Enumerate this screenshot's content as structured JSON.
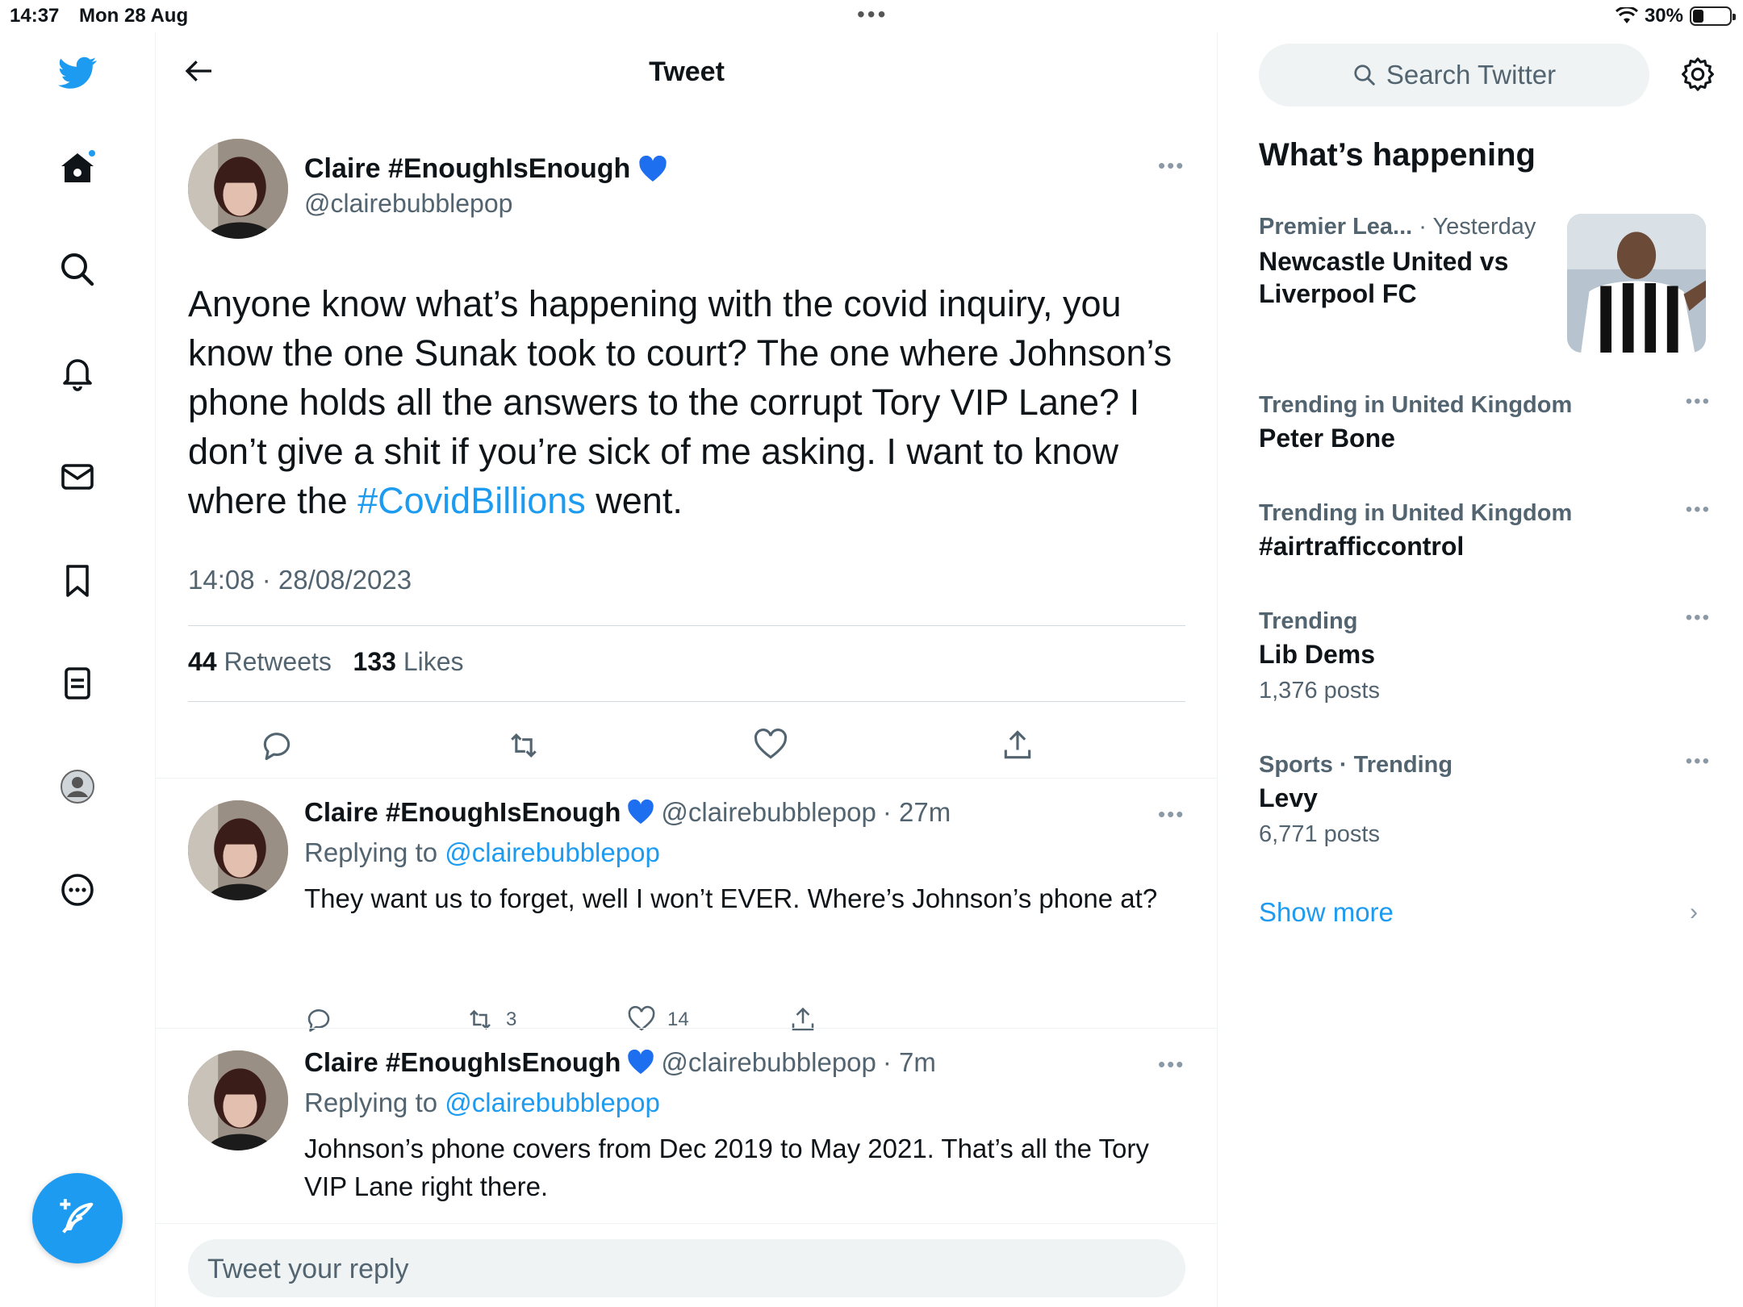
{
  "status_bar": {
    "time": "14:37",
    "date": "Mon 28 Aug",
    "battery": "30%",
    "battery_level": 0.3
  },
  "nav": {
    "items": [
      "home",
      "explore",
      "notifications",
      "messages",
      "bookmarks",
      "lists",
      "profile",
      "more"
    ]
  },
  "header": {
    "title": "Tweet"
  },
  "main_tweet": {
    "name": "Claire #EnoughIsEnough",
    "handle": "@clairebubblepop",
    "text_before": "Anyone know what’s happening with the covid inquiry, you know the one Sunak took to court? The one where Johnson’s phone holds all the answers to the corrupt Tory VIP Lane? I don’t give a shit if you’re sick of me asking. I want to know where the ",
    "hashtag": "#CovidBillions",
    "text_after": " went.",
    "timestamp": "14:08 · 28/08/2023",
    "retweets_count": "44",
    "retweets_label": "Retweets",
    "likes_count": "133",
    "likes_label": "Likes"
  },
  "replies": [
    {
      "name": "Claire #EnoughIsEnough",
      "handle": "@clairebubblepop",
      "time": "· 27m",
      "replying_label": "Replying to",
      "replying_to": "@clairebubblepop",
      "text": "They want us to forget, well I won’t EVER. Where’s Johnson’s phone at?",
      "retweets": "3",
      "likes": "14"
    },
    {
      "name": "Claire #EnoughIsEnough",
      "handle": "@clairebubblepop",
      "time": "· 7m",
      "replying_label": "Replying to",
      "replying_to": "@clairebubblepop",
      "text": "Johnson’s phone covers from Dec 2019 to May 2021. That’s all the Tory VIP Lane right there."
    }
  ],
  "reply_box": {
    "placeholder": "Tweet your reply"
  },
  "sidebar": {
    "search_placeholder": "Search Twitter",
    "whats_happening": "What’s happening",
    "news": {
      "category": "Premier Lea...",
      "time": "· Yesterday",
      "headline": "Newcastle United vs Liverpool FC"
    },
    "trends": [
      {
        "meta": "Trending in United Kingdom",
        "name": "Peter Bone",
        "count": ""
      },
      {
        "meta": "Trending in United Kingdom",
        "name": "#airtrafficcontrol",
        "count": ""
      },
      {
        "meta": "Trending",
        "name": "Lib Dems",
        "count": "1,376 posts"
      },
      {
        "meta": "Sports · Trending",
        "name": "Levy",
        "count": "6,771 posts"
      }
    ],
    "show_more": "Show more"
  },
  "colors": {
    "accent": "#1d9bf0",
    "text": "#0f1419",
    "muted": "#536471"
  }
}
